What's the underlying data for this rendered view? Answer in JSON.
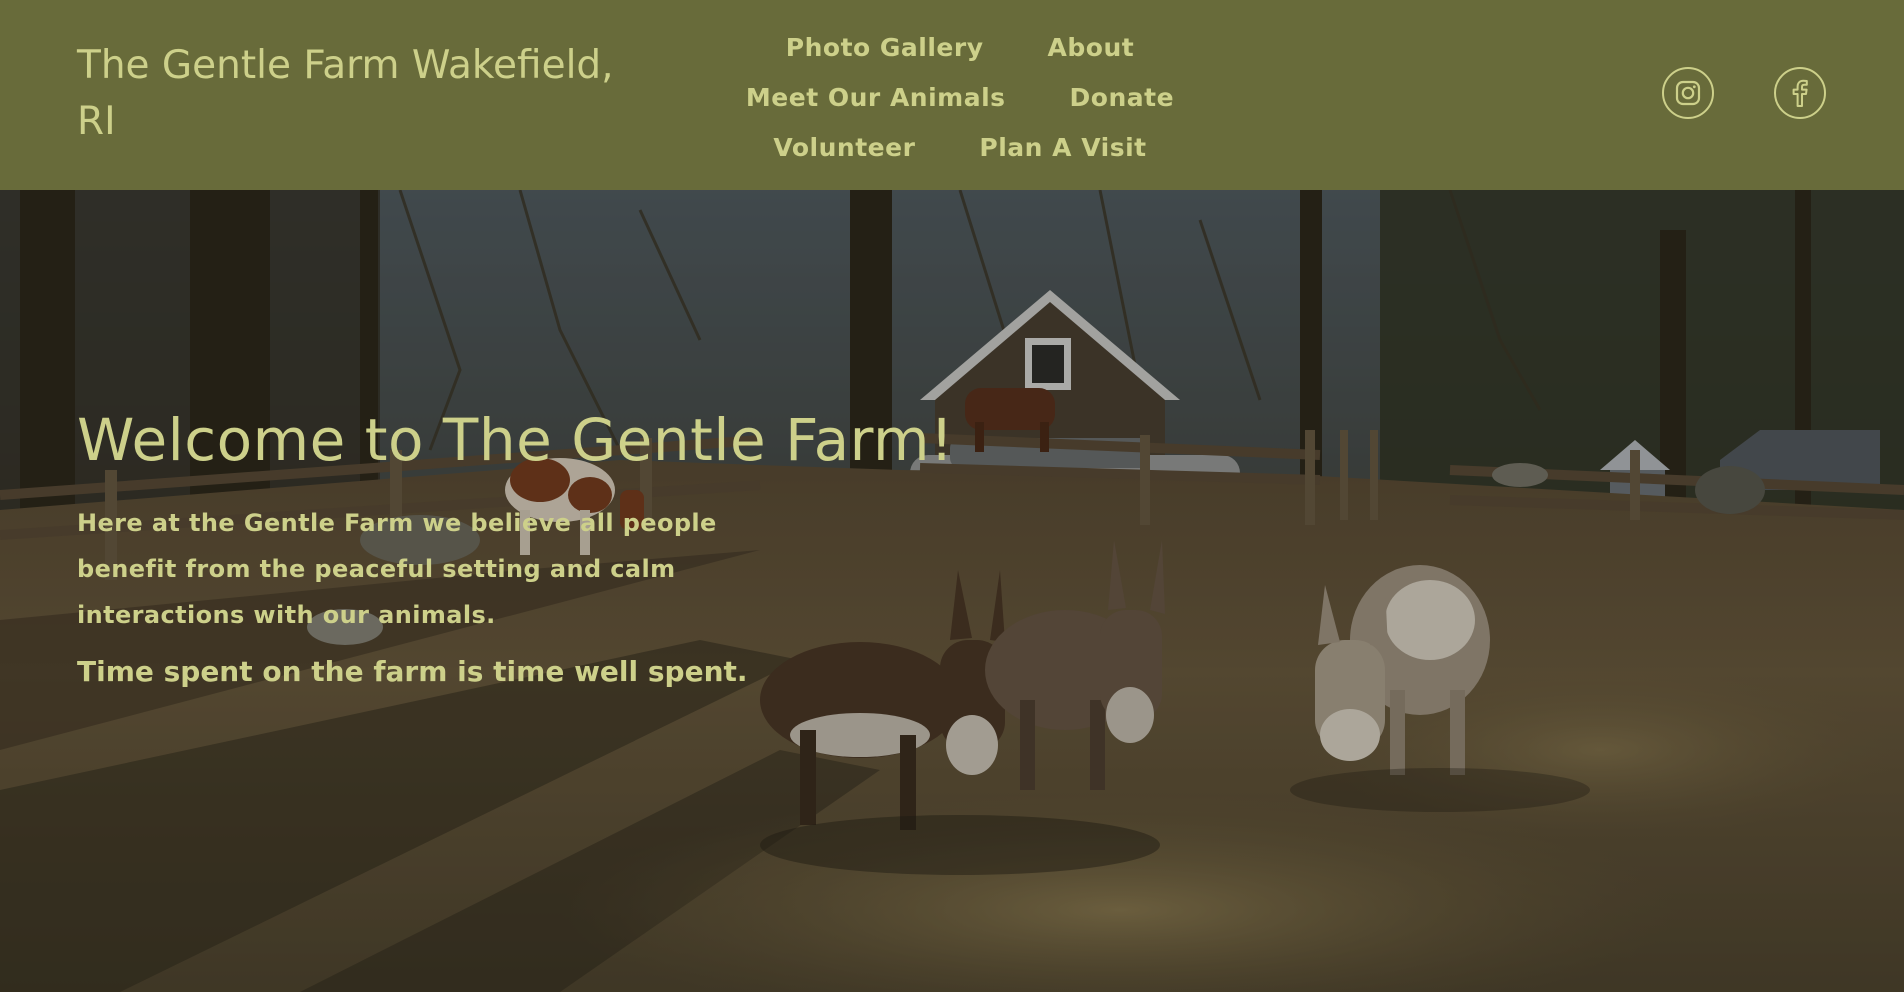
{
  "header": {
    "site_title": "The Gentle Farm Wakefield, RI",
    "nav": {
      "row1": [
        "Photo Gallery",
        "About"
      ],
      "row2": [
        "Meet Our Animals",
        "Donate"
      ],
      "row3": [
        "Volunteer",
        "Plan A Visit"
      ]
    },
    "social": {
      "instagram_icon": "instagram-icon",
      "facebook_icon": "facebook-icon"
    }
  },
  "hero": {
    "heading": "Welcome to The Gentle Farm!",
    "body": "Here at the Gentle Farm we believe all people benefit from the peaceful setting and calm interactions with our animals.",
    "tagline": "Time spent on the farm is time well spent."
  },
  "colors": {
    "header_bg": "#686b3a",
    "accent_text": "#cdd08a"
  }
}
